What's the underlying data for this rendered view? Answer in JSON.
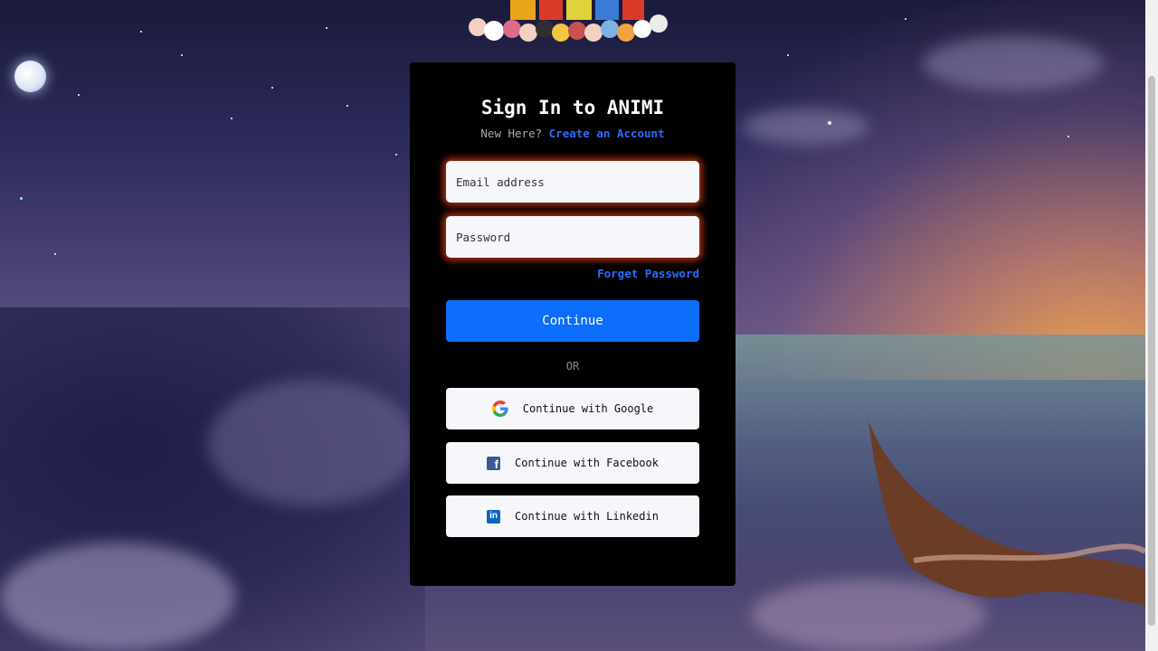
{
  "auth": {
    "title": "Sign In to ANIMI",
    "new_here": "New Here?",
    "create_account": "Create an Account",
    "email_placeholder": "Email address",
    "password_placeholder": "Password",
    "forgot_password": "Forget Password",
    "continue_label": "Continue",
    "or_label": "OR"
  },
  "social": [
    {
      "label": "Continue with Google",
      "icon": "google-icon"
    },
    {
      "label": "Continue with Facebook",
      "icon": "facebook-icon"
    },
    {
      "label": "Continue with Linkedin",
      "icon": "linkedin-icon"
    }
  ],
  "colors": {
    "card_bg": "#000000",
    "primary": "#0d6efd",
    "link": "#2a6cff",
    "field_glow": "#d63c14"
  }
}
